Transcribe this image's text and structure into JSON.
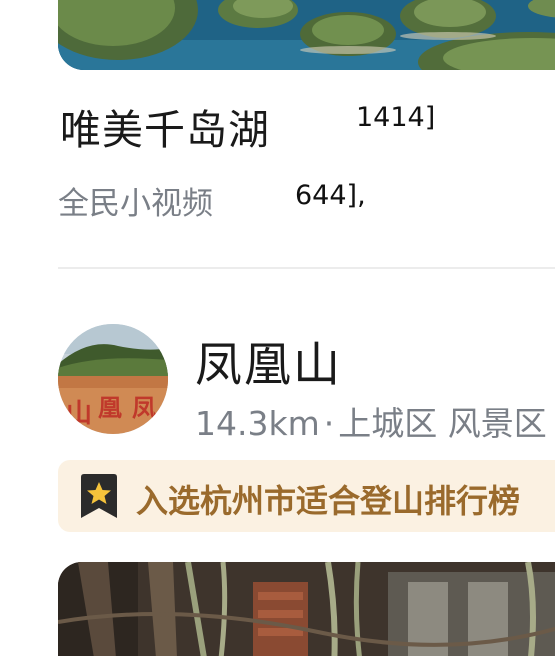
{
  "video": {
    "title": "唯美千岛湖",
    "source": "全民小视频",
    "stray_text_1": "1414]",
    "stray_text_2": "644],"
  },
  "place": {
    "name": "凤凰山",
    "distance": "14.3km",
    "separator": "·",
    "district": "上城区",
    "category": "风景区"
  },
  "ranking": {
    "icon": "star-bookmark-icon",
    "text": "入选杭州市适合登山排行榜"
  },
  "colors": {
    "banner_bg": "#fbf1e2",
    "banner_text": "#9a6a2c",
    "icon_star": "#f5c33b",
    "icon_bookmark": "#2b2b2b"
  }
}
